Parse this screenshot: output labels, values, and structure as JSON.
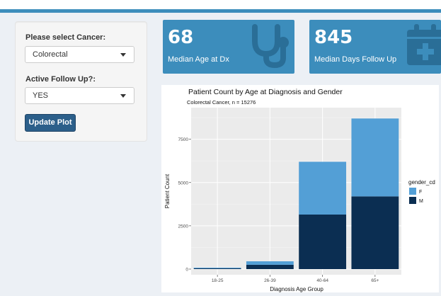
{
  "sidebar": {
    "cancer_label": "Please select Cancer:",
    "cancer_value": "Colorectal",
    "followup_label": "Active Follow Up?:",
    "followup_value": "YES",
    "update_button": "Update Plot"
  },
  "value_boxes": [
    {
      "value": "68",
      "subtitle": "Median Age at Dx",
      "icon": "stethoscope-icon"
    },
    {
      "value": "845",
      "subtitle": "Median Days Follow Up",
      "icon": "calendar-plus-icon"
    }
  ],
  "colors": {
    "header": "#3c8dbc",
    "value_box": "#3c8dbc",
    "button": "#2c5f8a",
    "series_F": "#539fd6",
    "series_M": "#0b2e52",
    "panel_bg": "#ebebeb"
  },
  "chart_data": {
    "type": "bar",
    "stacked": true,
    "title": "Patient Count by Age at Diagnosis and Gender",
    "subtitle": "Colorectal Cancer, n =  15276",
    "xlabel": "Diagnosis Age Group",
    "ylabel": "Patient Count",
    "categories": [
      "18-25",
      "26-39",
      "40-64",
      "65+"
    ],
    "series": [
      {
        "name": "M",
        "values": [
          40,
          250,
          3150,
          4200
        ]
      },
      {
        "name": "F",
        "values": [
          40,
          200,
          3050,
          4500
        ]
      }
    ],
    "yticks": [
      0,
      2500,
      5000,
      7500
    ],
    "ytick_labels": [
      "0",
      "2500",
      "5000",
      "7500"
    ],
    "ylim": [
      0,
      9000
    ],
    "legend_title": "gender_cd",
    "legend_entries": [
      "F",
      "M"
    ],
    "legend_position": "right",
    "grid": true
  }
}
